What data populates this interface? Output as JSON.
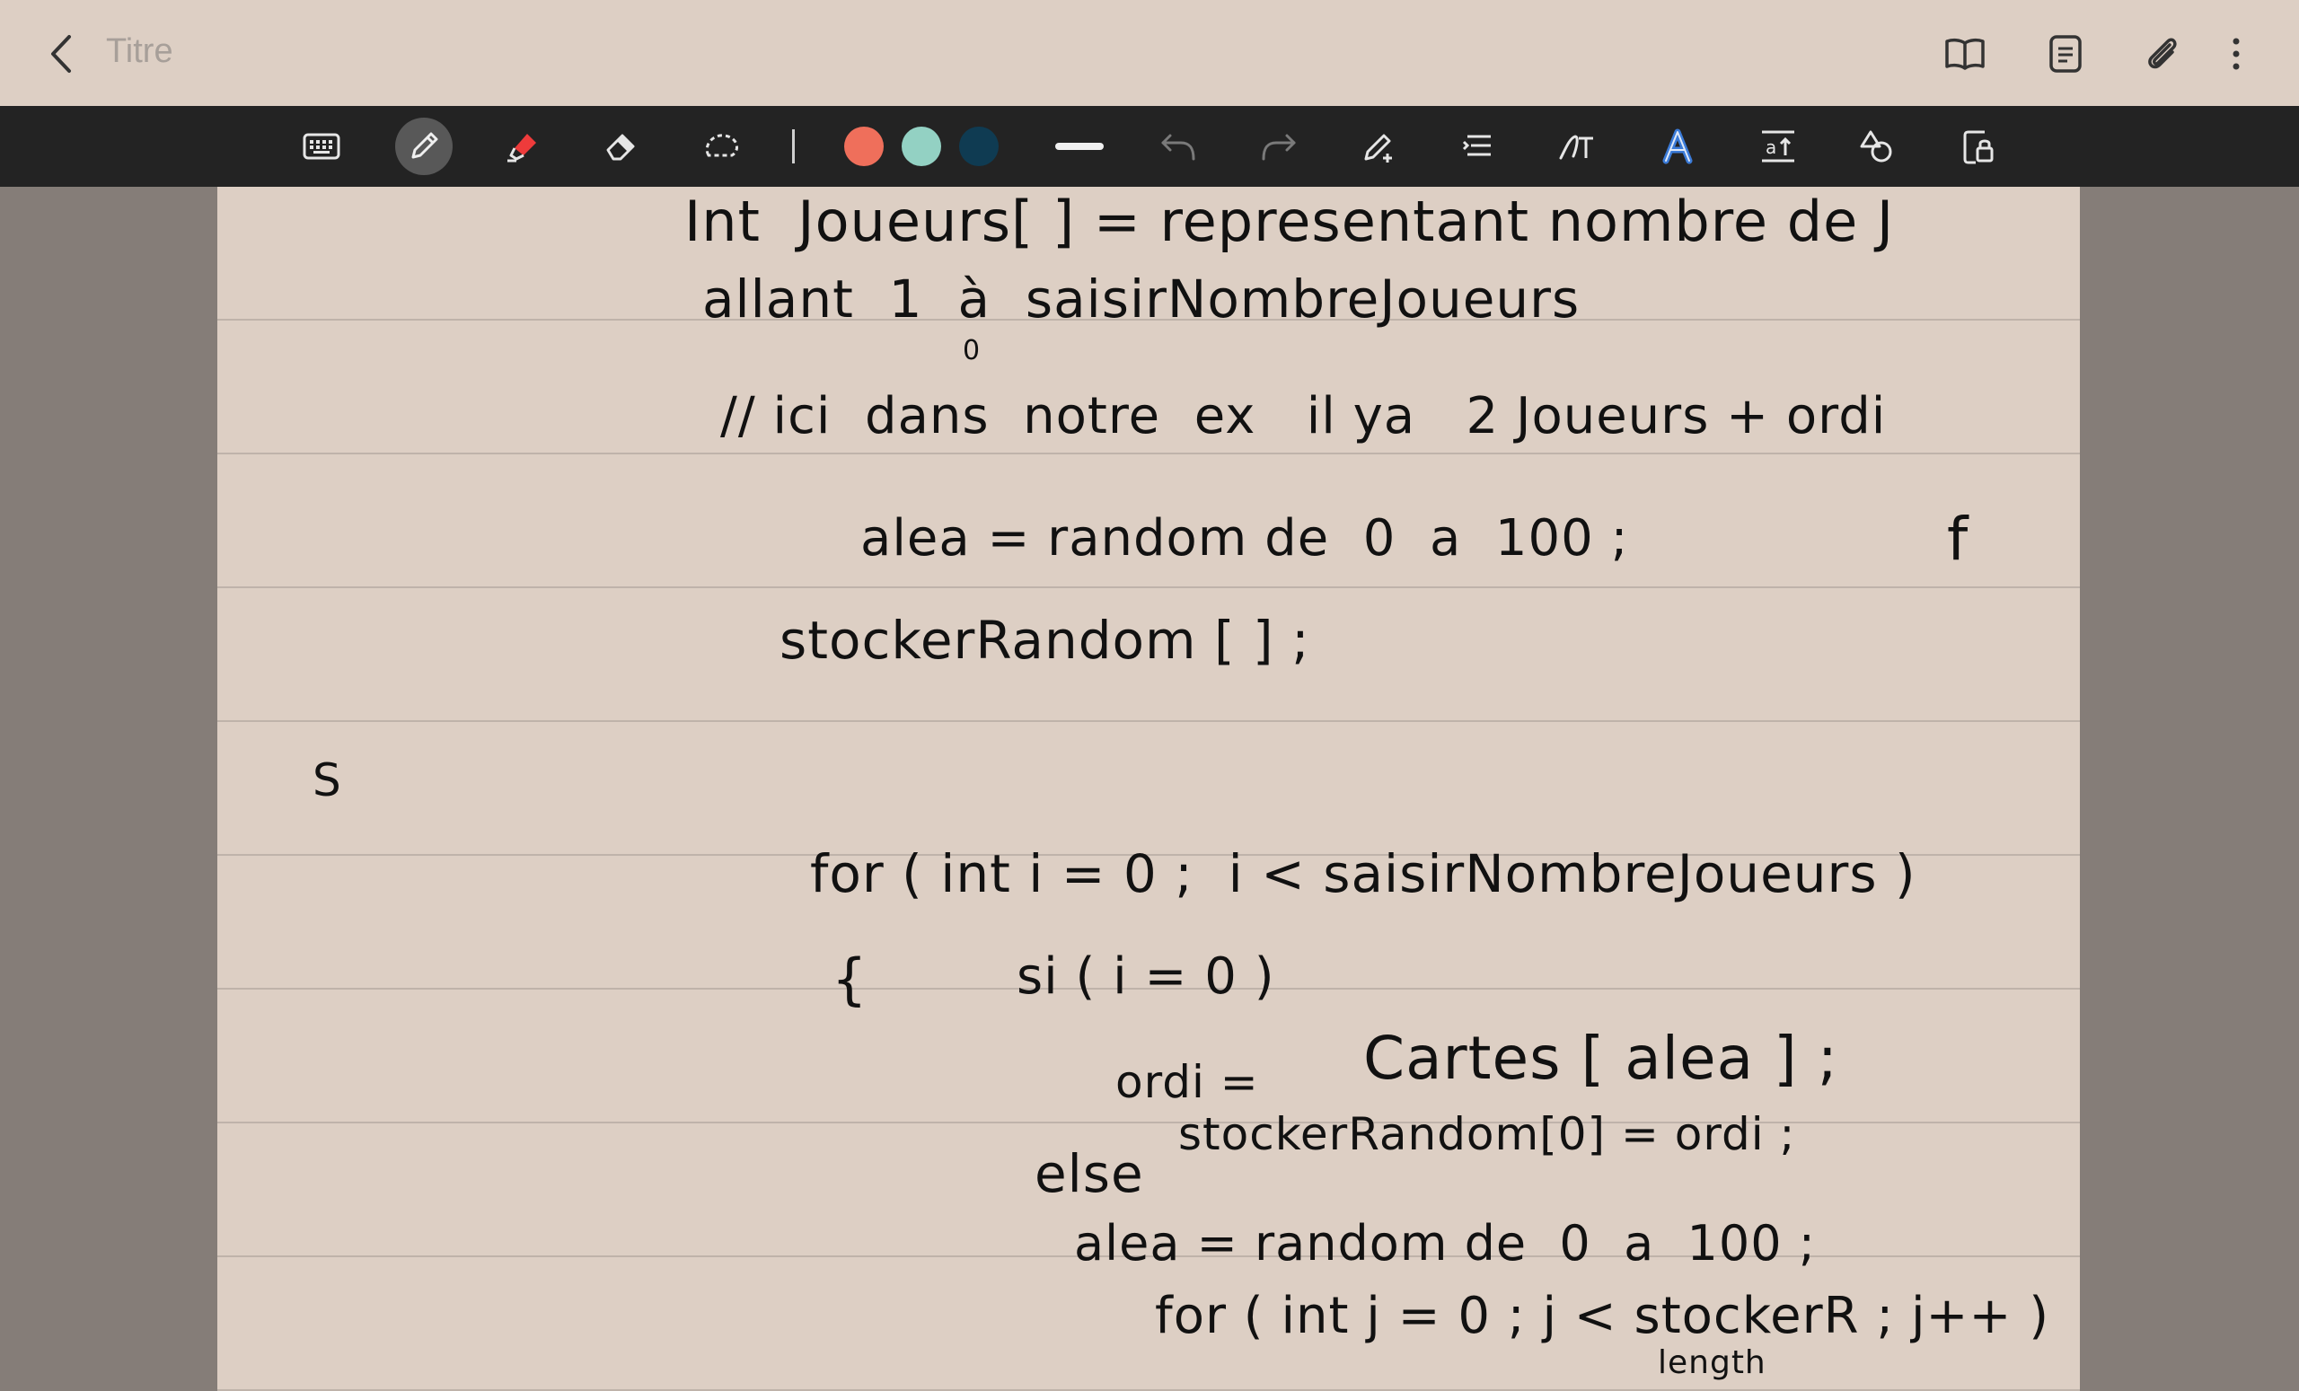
{
  "header": {
    "title_placeholder": "Titre"
  },
  "toolbar": {
    "colors": [
      "#ef6f5b",
      "#93d1c3",
      "#0f3b52"
    ],
    "active_tool": "pen"
  },
  "note": {
    "lines": [
      "Int  Joueurs[ ] = representant nombre de J",
      "allant  1  à  saisirNombreJoueurs",
      "0",
      "// ici  dans  notre  ex   il ya   2 Joueurs + ordi",
      "alea = random de  0  a  100 ;",
      "f",
      "stockerRandom [ ] ;",
      "S",
      "for ( int i = 0 ;  i < saisirNombreJoueurs )",
      "{",
      "si ( i = 0 )",
      "ordi =",
      "Cartes [ alea ] ;",
      "stockerRandom[0] = ordi ;",
      "else",
      "alea = random de  0  a  100 ;",
      "for ( int j = 0 ; j < stockerR ; j++ )",
      "length"
    ]
  }
}
